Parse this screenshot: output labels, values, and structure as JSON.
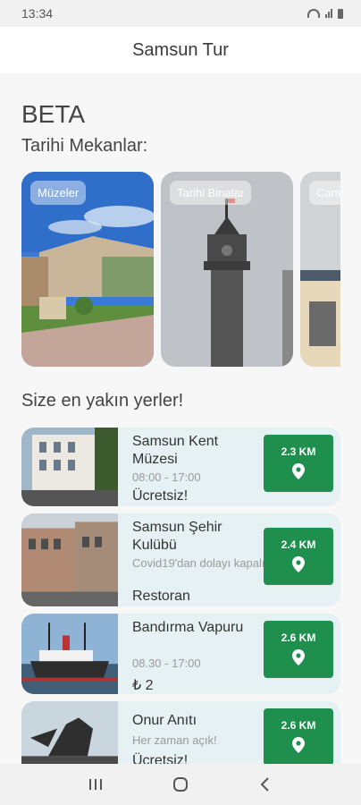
{
  "status": {
    "time": "13:34"
  },
  "app": {
    "title": "Samsun Tur"
  },
  "main": {
    "beta_label": "BETA",
    "historic_title": "Tarihi Mekanlar:",
    "categories": [
      {
        "label": "Müzeler"
      },
      {
        "label": "Tarihi Binalar"
      },
      {
        "label": "Cam"
      }
    ],
    "nearby_title": "Size en yakın yerler!",
    "places": [
      {
        "name": "Samsun Kent Müzesi",
        "hours": "08:00 - 17:00",
        "price": "Ücretsiz!",
        "distance": "2.3 KM"
      },
      {
        "name": "Samsun Şehir Kulübü",
        "hours": "Covid19'dan dolayı kapalı",
        "price": "Restoran",
        "distance": "2.4 KM"
      },
      {
        "name": "Bandırma Vapuru",
        "hours": "08.30 - 17:00",
        "price": "₺ 2",
        "distance": "2.6 KM"
      },
      {
        "name": "Onur Anıtı",
        "hours": "Her zaman açık!",
        "price": "Ücretsiz!",
        "distance": "2.6 KM"
      }
    ]
  },
  "colors": {
    "distance_badge": "#1f8f4e",
    "card_bg": "#e5f1f2"
  }
}
